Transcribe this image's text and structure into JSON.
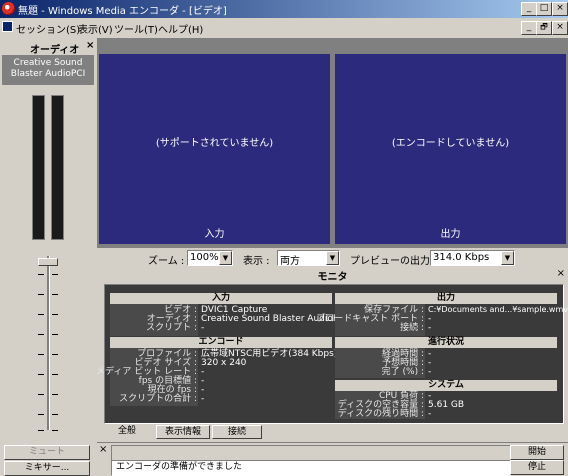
{
  "titlebar": {
    "title": "無題 - Windows Media エンコーダ - [ビデオ]",
    "min": "_",
    "max": "□",
    "close": "×"
  },
  "menubar": {
    "items": [
      "セッション(S)",
      "表示(V)",
      "ツール(T)",
      "ヘルプ(H)"
    ],
    "mdi_min": "_",
    "mdi_restore": "🗗",
    "mdi_close": "×"
  },
  "audio": {
    "header": "オーディオ",
    "close": "×",
    "device": "Creative Sound Blaster AudioPCI",
    "mute": "ミュート",
    "mixer": "ミキサー..."
  },
  "video": {
    "input_message": "(サポートされていません)",
    "output_message": "(エンコードしていません)",
    "input_label": "入力",
    "output_label": "出力"
  },
  "controls": {
    "zoom_label": "ズーム :",
    "zoom_value": "100%",
    "view_label": "表示 :",
    "view_value": "両方",
    "preview_label": "プレビューの出力 :",
    "preview_value": "314.0 Kbps"
  },
  "monitor": {
    "header": "モニタ",
    "close": "×",
    "input": {
      "title": "入力",
      "labels": [
        "ビデオ :",
        "オーディオ :",
        "スクリプト :"
      ],
      "values": [
        "DVIC1 Capture",
        "Creative Sound Blaster AudioPCI",
        "-"
      ]
    },
    "output": {
      "title": "出力",
      "labels": [
        "保存ファイル :",
        "ブロードキャスト ポート :",
        "接続 :"
      ],
      "values": [
        "C:¥Documents and...¥sample.wmv",
        "-",
        "-"
      ]
    },
    "encode": {
      "title": "エンコード",
      "labels": [
        "プロファイル :",
        "ビデオ サイズ :",
        "メディア ビット レート :",
        "fps の目標値 :",
        "現在の fps :",
        "スクリプトの合計 :"
      ],
      "values": [
        "広帯域NTSC用ビデオ(384 Kbps)",
        "320 x 240",
        "-",
        "-",
        "-",
        "-"
      ]
    },
    "progress": {
      "title": "進行状況",
      "labels": [
        "経過時間 :",
        "予想時間 :",
        "完了 (%) :"
      ],
      "values": [
        "-",
        "-",
        "-"
      ]
    },
    "system": {
      "title": "システム",
      "labels": [
        "CPU 負荷 :",
        "ディスクの空き容量 :",
        "ディスクの残り時間 :"
      ],
      "values": [
        "-",
        "5.61 GB",
        "-"
      ]
    },
    "tabs": [
      "全般",
      "表示情報",
      "接続"
    ]
  },
  "bottom": {
    "close": "×",
    "status_text": "エンコーダの準備ができました",
    "start": "開始",
    "stop": "停止"
  }
}
